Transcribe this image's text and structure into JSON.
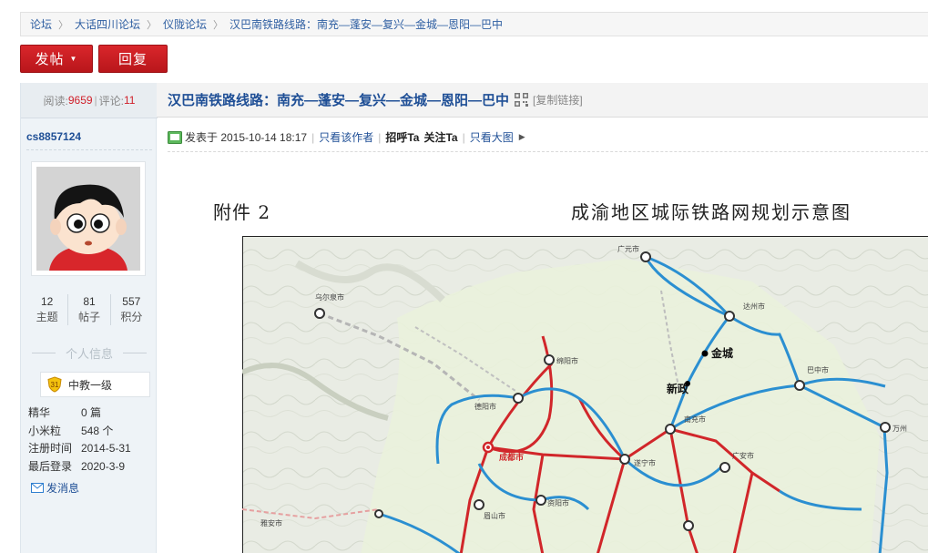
{
  "breadcrumb": [
    "论坛",
    "大话四川论坛",
    "仪陇论坛",
    "汉巴南铁路线路：南充—蓬安—复兴—金城—恩阳—巴中"
  ],
  "buttons": {
    "post": "发帖",
    "reply": "回复"
  },
  "thread_stats": {
    "read_label": "阅读:",
    "read_value": "9659",
    "comment_label": "评论:",
    "comment_value": "11"
  },
  "thread_title": "汉巴南铁路线路：南充—蓬安—复兴—金城—恩阳—巴中",
  "copy_link": "[复制链接]",
  "author": {
    "name": "cs8857124",
    "stats": [
      {
        "value": "12",
        "label": "主题"
      },
      {
        "value": "81",
        "label": "帖子"
      },
      {
        "value": "557",
        "label": "积分"
      }
    ],
    "section_title": "个人信息",
    "rank_level": "31",
    "rank_name": "中教一级",
    "info": [
      {
        "k": "精华",
        "v": "0 篇"
      },
      {
        "k": "小米粒",
        "v": "548 个"
      },
      {
        "k": "注册时间",
        "v": "2014-5-31"
      },
      {
        "k": "最后登录",
        "v": "2020-3-9"
      }
    ],
    "message": "发消息"
  },
  "post_meta": {
    "posted": "发表于 2015-10-14 18:17",
    "only_author": "只看该作者",
    "greet": "招呼Ta",
    "follow": "关注Ta",
    "big_image": "只看大图"
  },
  "figure": {
    "caption_left": "附件 2",
    "caption_right": "成渝地区城际铁路网规划示意图",
    "labels": {
      "jincheng": "金城",
      "xinzheng": "新政",
      "chengdu": "成都市",
      "wuluqi": "乌尔泉市",
      "guangyuan": "广元市",
      "mianyang": "绵阳市",
      "bazhong": "巴中市",
      "dazhou": "达州市",
      "nanchong": "南充市",
      "suining": "遂宁市",
      "ziyang": "资阳市",
      "meishan": "眉山市",
      "deyang": "德阳市",
      "wanzhou": "万州",
      "yaan": "雅安市",
      "guangan": "广安市"
    }
  },
  "colors": {
    "accent": "#d0202a",
    "link": "#1f4f96",
    "rail_red": "#d1262a",
    "rail_blue": "#2b8fd1"
  }
}
